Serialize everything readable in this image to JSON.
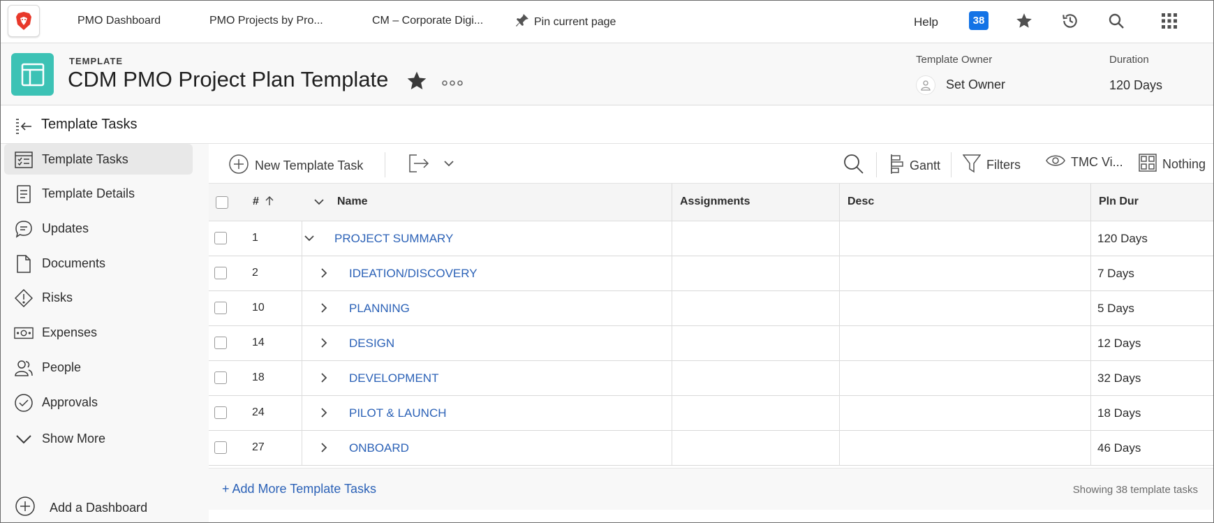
{
  "topnav": {
    "logo_icon": "brave-lion-icon",
    "links": [
      "PMO Dashboard",
      "PMO Projects by Pro...",
      "CM – Corporate Digi..."
    ],
    "pin_label": "Pin current page",
    "help_label": "Help",
    "notifications_count": "38",
    "icons": [
      "star-icon",
      "history-icon",
      "search-icon",
      "app-grid-icon"
    ]
  },
  "header": {
    "kicker": "TEMPLATE",
    "title": "CDM PMO Project Plan Template",
    "more_label": "···",
    "owner_label": "Template Owner",
    "owner_value": "Set Owner",
    "duration_label": "Duration",
    "duration_value": "120 Days",
    "accent_color": "#3cc2b5"
  },
  "section": {
    "title": "Template Tasks"
  },
  "sidebar": {
    "items": [
      {
        "label": "Template Tasks",
        "icon": "task-list-icon",
        "active": true
      },
      {
        "label": "Template Details",
        "icon": "document-lines-icon"
      },
      {
        "label": "Updates",
        "icon": "speech-bubble-icon"
      },
      {
        "label": "Documents",
        "icon": "file-icon"
      },
      {
        "label": "Risks",
        "icon": "warning-diamond-icon"
      },
      {
        "label": "Expenses",
        "icon": "money-icon"
      },
      {
        "label": "People",
        "icon": "people-icon"
      },
      {
        "label": "Approvals",
        "icon": "check-circle-icon"
      },
      {
        "label": "Show More",
        "icon": "chevron-down-icon"
      }
    ],
    "add_dashboard": "Add a Dashboard"
  },
  "toolbar": {
    "new_task": "New Template Task",
    "gantt": "Gantt",
    "filters": "Filters",
    "view": "TMC Vi...",
    "grouping": "Nothing"
  },
  "table": {
    "columns": {
      "number": "#",
      "name": "Name",
      "assignments": "Assignments",
      "desc": "Desc",
      "pln_dur": "Pln Dur"
    },
    "rows": [
      {
        "num": "1",
        "name": "PROJECT SUMMARY",
        "dur": "120 Days",
        "expanded": true
      },
      {
        "num": "2",
        "name": "IDEATION/DISCOVERY",
        "dur": "7 Days"
      },
      {
        "num": "10",
        "name": "PLANNING",
        "dur": "5 Days"
      },
      {
        "num": "14",
        "name": "DESIGN",
        "dur": "12 Days"
      },
      {
        "num": "18",
        "name": "DEVELOPMENT",
        "dur": "32 Days"
      },
      {
        "num": "24",
        "name": "PILOT & LAUNCH",
        "dur": "18 Days"
      },
      {
        "num": "27",
        "name": "ONBOARD",
        "dur": "46 Days"
      }
    ],
    "add_more": "+ Add More Template Tasks",
    "showing": "Showing 38 template tasks",
    "link_color": "#2c62b7"
  }
}
